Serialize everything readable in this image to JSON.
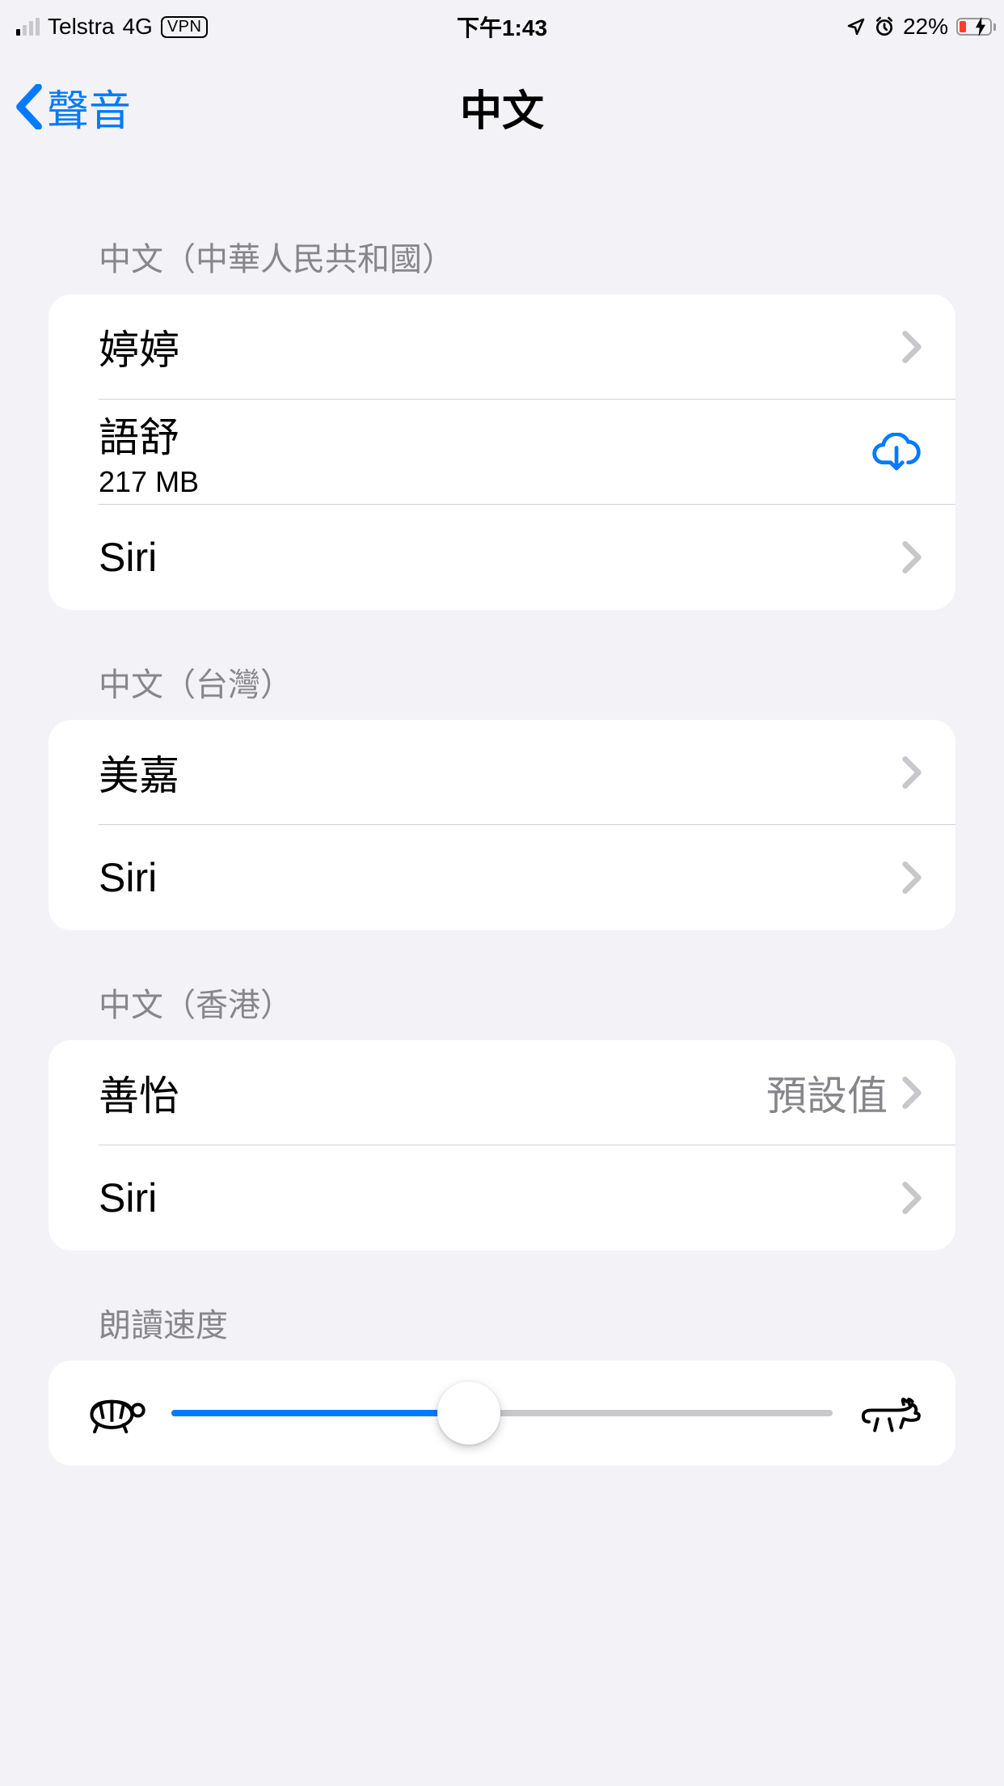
{
  "statusBar": {
    "carrier": "Telstra",
    "network": "4G",
    "vpn": "VPN",
    "time": "下午1:43",
    "battery": "22%"
  },
  "nav": {
    "back": "聲音",
    "title": "中文"
  },
  "sections": [
    {
      "header": "中文（中華人民共和國）",
      "rows": [
        {
          "title": "婷婷",
          "accessory": "chevron"
        },
        {
          "title": "語舒",
          "subtitle": "217 MB",
          "accessory": "download"
        },
        {
          "title": "Siri",
          "accessory": "chevron"
        }
      ]
    },
    {
      "header": "中文（台灣）",
      "rows": [
        {
          "title": "美嘉",
          "accessory": "chevron"
        },
        {
          "title": "Siri",
          "accessory": "chevron"
        }
      ]
    },
    {
      "header": "中文（香港）",
      "rows": [
        {
          "title": "善怡",
          "detail": "預設值",
          "accessory": "chevron"
        },
        {
          "title": "Siri",
          "accessory": "chevron"
        }
      ]
    }
  ],
  "speed": {
    "header": "朗讀速度",
    "value": 45
  }
}
